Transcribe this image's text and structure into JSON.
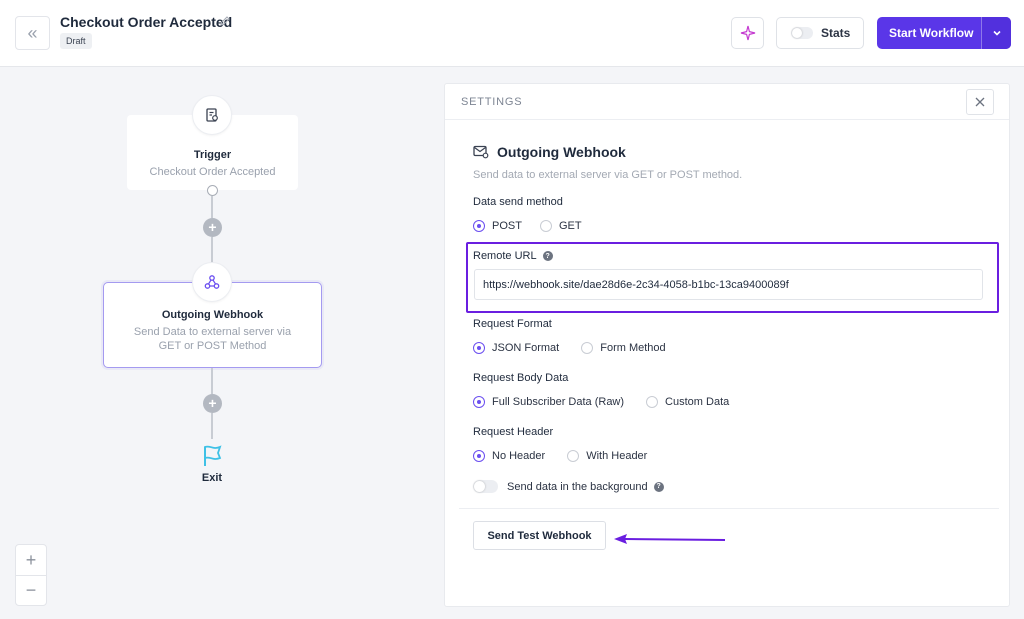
{
  "header": {
    "title": "Checkout Order Accepted",
    "status_badge": "Draft",
    "stats_label": "Stats",
    "start_label": "Start Workflow"
  },
  "canvas": {
    "trigger": {
      "title": "Trigger",
      "subtitle": "Checkout Order Accepted"
    },
    "webhook": {
      "title": "Outgoing Webhook",
      "subtitle_line1": "Send Data to external server via",
      "subtitle_line2": "GET or POST Method"
    },
    "exit_label": "Exit",
    "zoom_in": "+",
    "zoom_out": "−"
  },
  "panel": {
    "header": "SETTINGS",
    "section_title": "Outgoing Webhook",
    "section_desc": "Send data to external server via GET or POST method.",
    "send_method": {
      "label": "Data send method",
      "options": [
        "POST",
        "GET"
      ],
      "selected": "POST"
    },
    "remote_url": {
      "label": "Remote URL",
      "value": "https://webhook.site/dae28d6e-2c34-4058-b1bc-13ca9400089f"
    },
    "request_format": {
      "label": "Request Format",
      "options": [
        "JSON Format",
        "Form Method"
      ],
      "selected": "JSON Format"
    },
    "request_body": {
      "label": "Request Body Data",
      "options": [
        "Full Subscriber Data (Raw)",
        "Custom Data"
      ],
      "selected": "Full Subscriber Data (Raw)"
    },
    "request_header": {
      "label": "Request Header",
      "options": [
        "No Header",
        "With Header"
      ],
      "selected": "No Header"
    },
    "background": {
      "label": "Send data in the background",
      "enabled": false
    },
    "test_button": "Send Test Webhook"
  },
  "colors": {
    "accent": "#5a36e8",
    "highlight": "#6a1ee0",
    "exit_flag": "#3fc1e6"
  }
}
